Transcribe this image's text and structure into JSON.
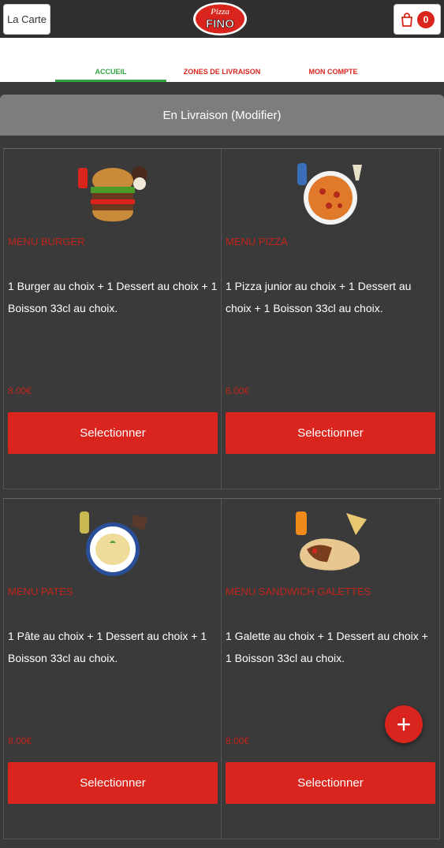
{
  "header": {
    "carte_label": "La Carte",
    "logo_top": "Pizza",
    "logo_main": "FINO",
    "cart_count": "0"
  },
  "nav": [
    {
      "label": "ACCUEIL"
    },
    {
      "label": "ZONES DE LIVRAISON"
    },
    {
      "label": "MON COMPTE"
    }
  ],
  "delivery_label": "En Livraison (Modifier)",
  "items": [
    {
      "title": "MENU BURGER",
      "desc": "1 Burger au choix  + 1 Dessert au choix  + 1 Boisson 33cl au choix.",
      "price": "8.00€",
      "button": "Selectionner",
      "image": "burger-icon"
    },
    {
      "title": "MENU PIZZA",
      "desc": "1 Pizza junior au choix  + 1 Dessert au choix  + 1 Boisson 33cl au choix.",
      "price": "8.00€",
      "button": "Selectionner",
      "image": "pizza-icon"
    },
    {
      "title": "MENU PATES",
      "desc": "1 Pâte au choix  + 1 Dessert au choix  + 1 Boisson 33cl au choix.",
      "price": "8.00€",
      "button": "Selectionner",
      "image": "pasta-icon"
    },
    {
      "title": "MENU SANDWICH GALETTES",
      "desc": "1 Galette au choix  + 1 Dessert au choix  + 1 Boisson 33cl au choix.",
      "price": "8.00€",
      "button": "Selectionner",
      "image": "wrap-icon"
    }
  ],
  "fab_label": "+",
  "colors": {
    "accent": "#d9251d",
    "active_nav": "#2fa640",
    "background": "#3a3a3a"
  }
}
